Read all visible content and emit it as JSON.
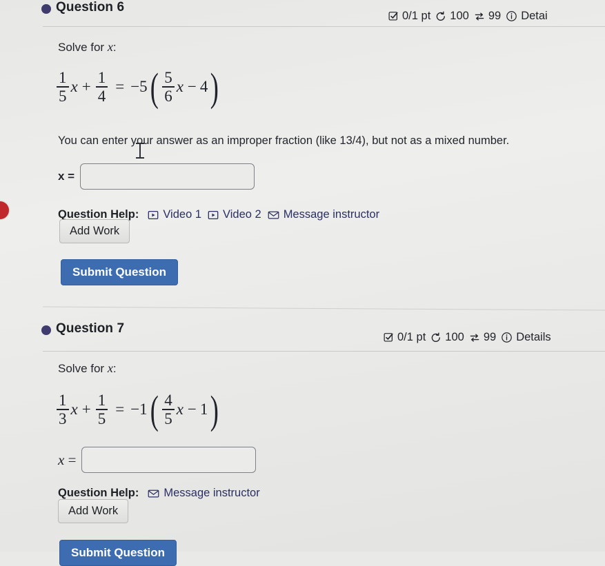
{
  "questions": [
    {
      "title": "Question 6",
      "meta": {
        "points": "0/1 pt",
        "attempts": "100",
        "retries": "99",
        "details": "Detai"
      },
      "prompt": "Solve for",
      "prompt_var": "x",
      "prompt_colon": ":",
      "equation": {
        "lhs_frac_num": "1",
        "lhs_frac_den": "5",
        "lhs_var": "x",
        "plus": "+",
        "lhs2_num": "1",
        "lhs2_den": "4",
        "equals": "=",
        "coefficient": "−5",
        "paren_open": "(",
        "rhs_num": "5",
        "rhs_den": "6",
        "rhs_var": "x",
        "minus": "−",
        "constant": "4",
        "paren_close": ")"
      },
      "note": "You can enter your answer as an improper fraction (like 13/4), but not as a mixed number.",
      "answer_label": "x =",
      "answer_value": "",
      "answer_placeholder": "",
      "help_label": "Question Help:",
      "help_links": [
        {
          "label": "Video 1",
          "icon": "video-play-icon"
        },
        {
          "label": "Video 2",
          "icon": "video-play-icon"
        },
        {
          "label": "Message instructor",
          "icon": "envelope-icon"
        }
      ],
      "add_work_label": "Add Work",
      "submit_label": "Submit Question"
    },
    {
      "title": "Question 7",
      "meta": {
        "points": "0/1 pt",
        "attempts": "100",
        "retries": "99",
        "details": "Details"
      },
      "prompt": "Solve for",
      "prompt_var": "x",
      "prompt_colon": ":",
      "equation": {
        "lhs_frac_num": "1",
        "lhs_frac_den": "3",
        "lhs_var": "x",
        "plus": "+",
        "lhs2_num": "1",
        "lhs2_den": "5",
        "equals": "=",
        "coefficient": "−1",
        "paren_open": "(",
        "rhs_num": "4",
        "rhs_den": "5",
        "rhs_var": "x",
        "minus": "−",
        "constant": "1",
        "paren_close": ")"
      },
      "note": "",
      "answer_label": "x =",
      "answer_value": "",
      "answer_placeholder": "",
      "help_label": "Question Help:",
      "help_links": [
        {
          "label": "Message instructor",
          "icon": "envelope-icon"
        }
      ],
      "add_work_label": "Add Work",
      "submit_label": "Submit Question"
    }
  ],
  "colors": {
    "bullet": "#3f3b6e",
    "submit_blue": "#3d6cb0",
    "link": "#2b2f63",
    "red_badge": "#c0272d",
    "page_bg": "#e9e9e7"
  },
  "icons": {
    "checkbox": "checkbox-check-icon",
    "clock": "clock-arrow-icon",
    "retry": "retry-swap-icon",
    "info": "info-circle-icon"
  }
}
